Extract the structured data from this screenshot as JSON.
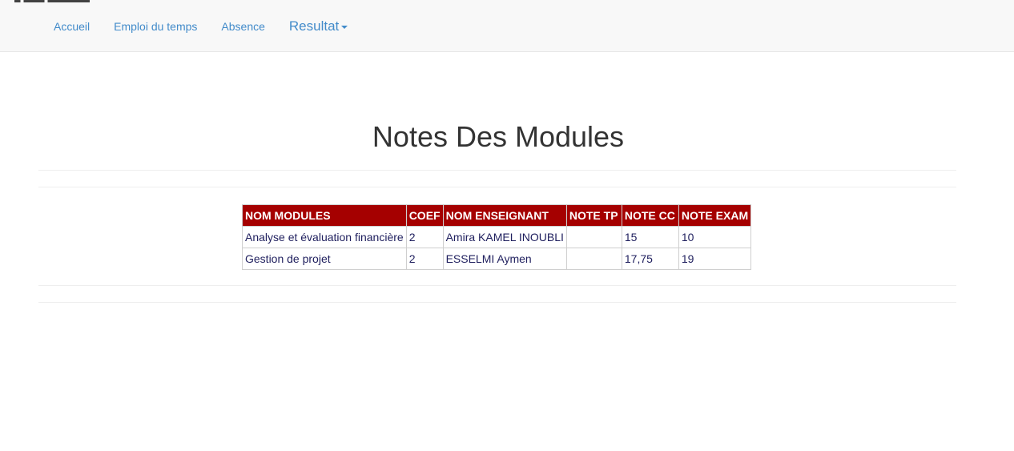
{
  "nav": {
    "items": [
      "Accueil",
      "Emploi du temps",
      "Absence"
    ],
    "dropdown_label": "Resultat"
  },
  "page": {
    "title": "Notes Des Modules"
  },
  "table": {
    "headers": [
      "NOM MODULES",
      "COEF",
      "NOM ENSEIGNANT",
      "NOTE TP",
      "NOTE CC",
      "NOTE EXAM"
    ],
    "rows": [
      [
        "Analyse et évaluation financière",
        "2",
        "Amira KAMEL INOUBLI",
        "",
        "15",
        "10"
      ],
      [
        "Gestion de projet",
        "2",
        "ESSELMI Aymen",
        "",
        "17,75",
        "19"
      ]
    ]
  },
  "colors": {
    "accent": "#428bca",
    "header_bg": "#a50000",
    "cell_text": "#1f1f5e"
  }
}
